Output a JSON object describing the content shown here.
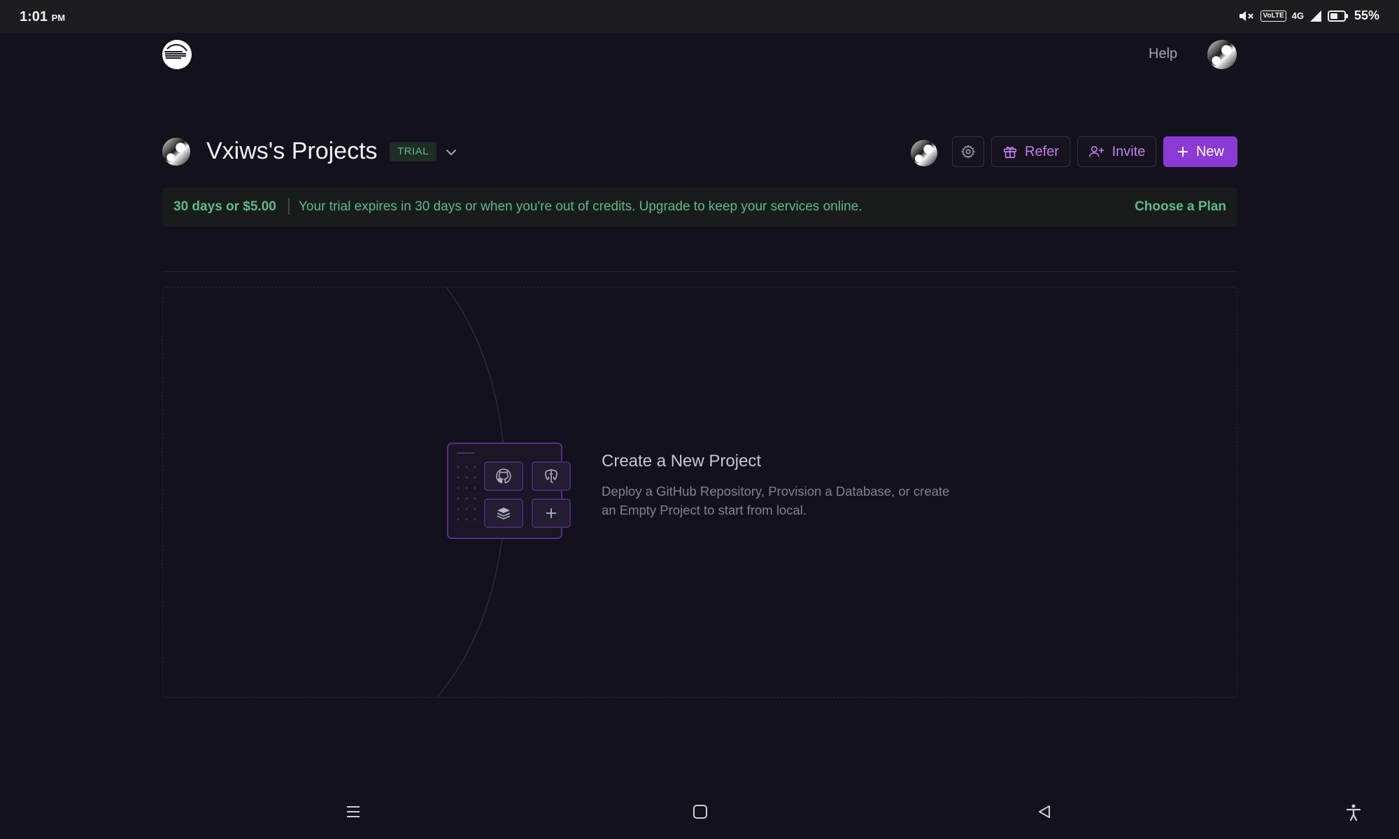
{
  "status_bar": {
    "time": "1:01",
    "meridiem": "PM",
    "volte": "VoLTE",
    "network": "4G",
    "battery": "55%"
  },
  "header": {
    "logo_icon": "railway-logo-icon",
    "help_label": "Help",
    "avatar_icon": "user-avatar"
  },
  "project": {
    "title": "Vxiws's Projects",
    "badge": "TRIAL",
    "buttons": {
      "refer_label": "Refer",
      "invite_label": "Invite",
      "new_label": "New"
    }
  },
  "trial_banner": {
    "amount": "30 days or $5.00",
    "message": "Your trial expires in 30 days or when you're out of credits. Upgrade to keep your services online.",
    "cta": "Choose a Plan"
  },
  "empty_state": {
    "title": "Create a New Project",
    "description": "Deploy a GitHub Repository, Provision a Database, or create an Empty Project to start from local.",
    "tiles": [
      "github-icon",
      "postgres-icon",
      "stack-icon",
      "plus-icon"
    ]
  },
  "colors": {
    "background": "#13111c",
    "accent": "#8b3ad6",
    "accent_text": "#c47cf0",
    "success_text": "#5fb98a"
  }
}
